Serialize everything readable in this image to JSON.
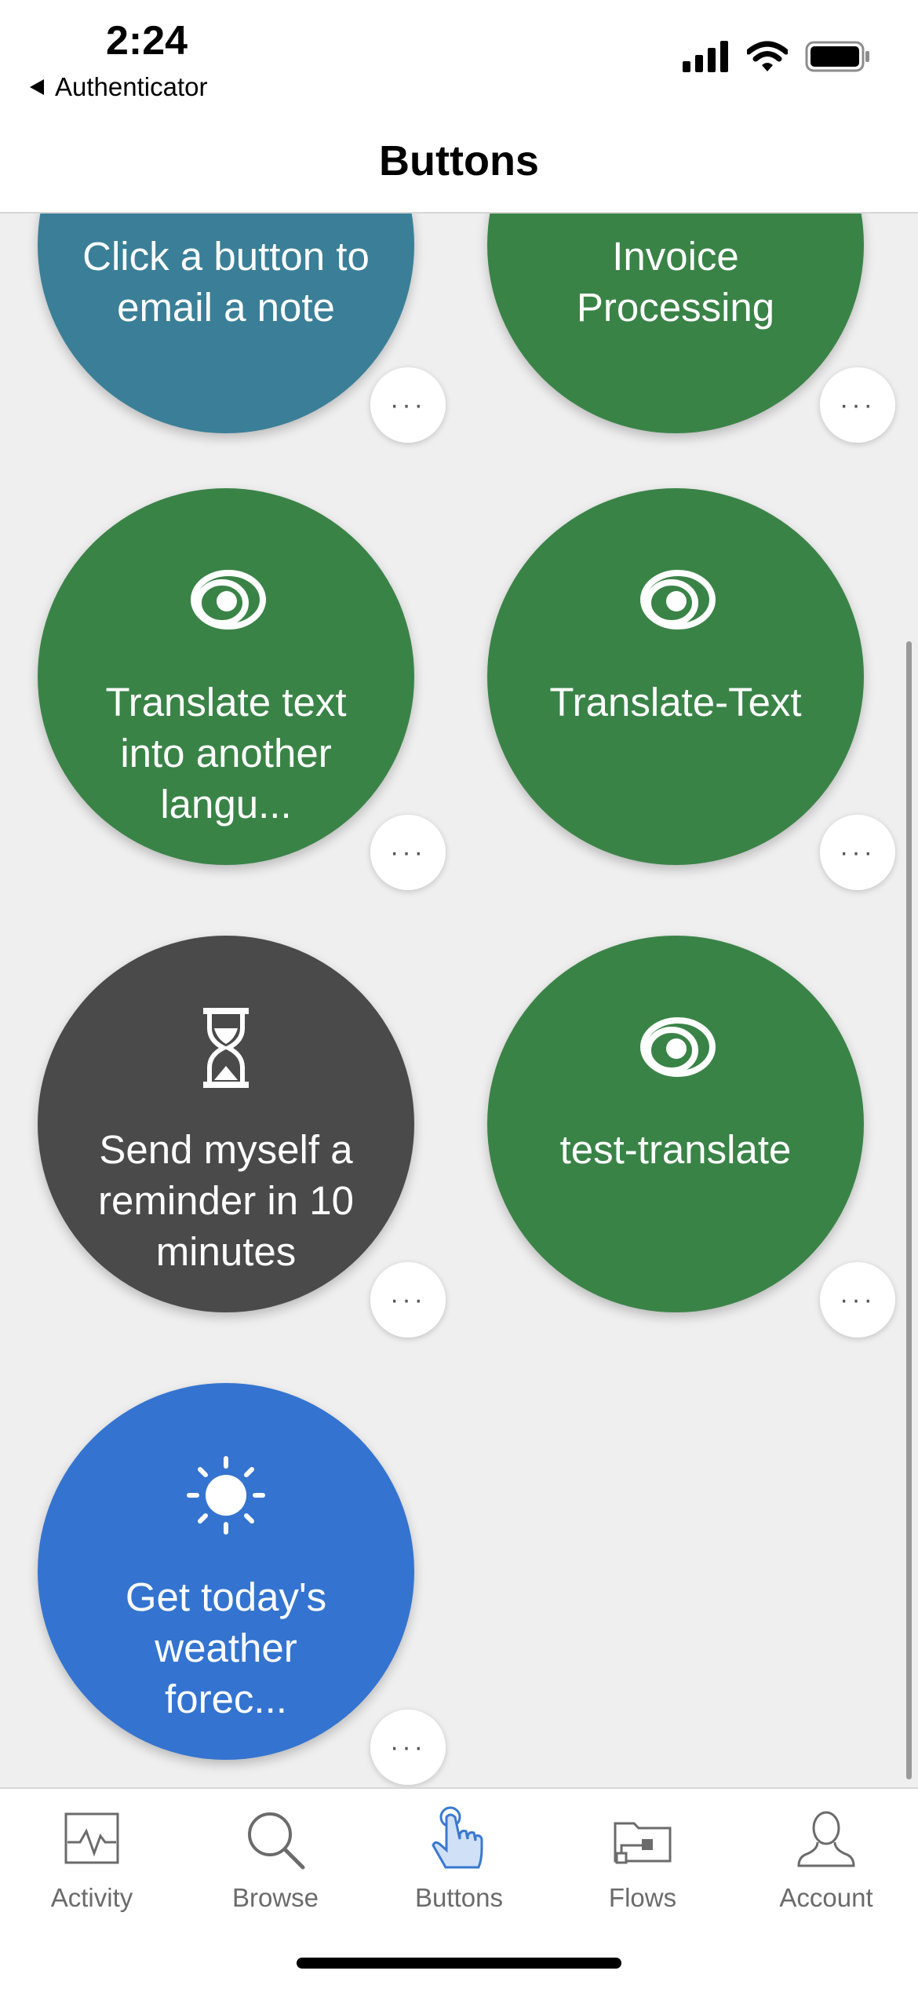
{
  "status_bar": {
    "time": "2:24",
    "back_app": "Authenticator",
    "icons": [
      "cellular-signal-icon",
      "wifi-icon",
      "battery-icon"
    ]
  },
  "nav": {
    "title": "Buttons"
  },
  "buttons": [
    {
      "label": "Click a button to email a note",
      "color": "#3a7f97",
      "icon": null
    },
    {
      "label": "Invoice Processing",
      "color": "#3a8347",
      "icon": null
    },
    {
      "label": "Translate text into another langu...",
      "color": "#3a8347",
      "icon": "translator-icon"
    },
    {
      "label": "Translate-Text",
      "color": "#3a8347",
      "icon": "translator-icon"
    },
    {
      "label": "Send myself a reminder in 10 minutes",
      "color": "#4a4a4a",
      "icon": "hourglass-icon"
    },
    {
      "label": "test-translate",
      "color": "#3a8347",
      "icon": "translator-icon"
    },
    {
      "label": "Get today's weather forec...",
      "color": "#3474d0",
      "icon": "sun-icon"
    }
  ],
  "more_label": "···",
  "tabs": [
    {
      "label": "Activity",
      "icon": "activity-icon",
      "active": false
    },
    {
      "label": "Browse",
      "icon": "magnifier-icon",
      "active": false
    },
    {
      "label": "Buttons",
      "icon": "tap-hand-icon",
      "active": true
    },
    {
      "label": "Flows",
      "icon": "flows-folder-icon",
      "active": false
    },
    {
      "label": "Account",
      "icon": "person-icon",
      "active": false
    }
  ],
  "colors": {
    "active_tab": "#3a78d0",
    "inactive_tab": "#6b6b6b"
  }
}
